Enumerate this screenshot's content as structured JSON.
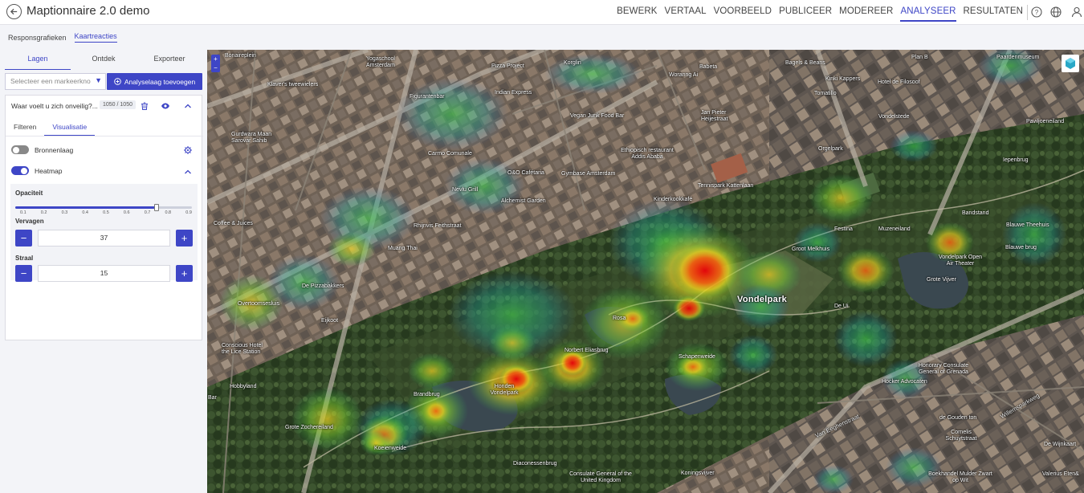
{
  "app": {
    "title": "Maptionnaire 2.0 demo"
  },
  "nav": {
    "items": [
      "BEWERK",
      "VERTAAL",
      "VOORBEELD",
      "PUBLICEER",
      "MODEREER",
      "ANALYSEER",
      "RESULTATEN"
    ],
    "active": "ANALYSEER"
  },
  "subtabs": [
    "Responsgrafieken",
    "Kaartreacties"
  ],
  "panel": {
    "tabs": [
      "Lagen",
      "Ontdek",
      "Exporteer"
    ],
    "select_placeholder": "Selecteer een markeerkno",
    "add_layer_label": "Analyselaag toevoegen",
    "layer": {
      "name": "Waar voelt u zich onveilig?...",
      "count": "1050 / 1050"
    },
    "card_tabs": [
      "Filteren",
      "Visualisatie"
    ],
    "bronnenlaag_label": "Bronnenlaag",
    "heatmap_label": "Heatmap",
    "opacity_label": "Opaciteit",
    "opacity_value": 0.8,
    "opacity_ticks": [
      "0.1",
      "0.2",
      "0.3",
      "0.4",
      "0.5",
      "0.6",
      "0.7",
      "0.8",
      "0.9"
    ],
    "blur_label": "Vervagen",
    "blur_value": "37",
    "radius_label": "Straal",
    "radius_value": "15"
  },
  "map_labels": {
    "vondelpark": "Vondelpark",
    "bonaireplein": "Bonaireplein",
    "yogaschool": "Yogaschool Amsterdam",
    "pizza_project": "Pizza Project",
    "korglin": "Korglin",
    "woranng": "Woranng Ai",
    "bakketa": "Babeta",
    "bagels": "Bagels & Beans",
    "plan_b": "Plan B",
    "paardenmuseum": "Paardenmuseum",
    "klaver": "Klaver's tweewielers",
    "figurantenbar": "Figurantenbar",
    "indian_express": "Indian Express",
    "vegan_junk": "Vegan Junk Food Bar",
    "jan_pieter": "Jan Pieter Heijestraat",
    "kinki": "Kinki Kappers",
    "hotel_filosoof": "Hotel de Filosoof",
    "tomatillo": "Tomatillo",
    "gurdwara": "Gurdwara Maan Sarovar Sahib",
    "vondelstede": "Vondelstede",
    "pavilioen": "Paviljoeneiland",
    "ethiopisch": "Ethiopisch restaurant Addis Ababa",
    "orgelpark": "Orgelpark",
    "iepenbrug": "Iepenbrug",
    "carmo": "Carmo Comunale",
    "danzigerstraat": "Danzigerstraat",
    "cafe_1": "O&O Cafétaria",
    "gymbase": "Gymbase Amsterdam",
    "nevlu": "Nevlu Grill",
    "tennispark": "Tennispark Kattenlaan",
    "alchemist": "Alchemist Garden",
    "kinderkookkafe": "Kinderkookkafé",
    "coffee_juices": "Coffee & Juices",
    "feithstraat": "Rhijnvis Feithstraat",
    "muzeneiland": "Muzeneiland",
    "bandstand": "Bandstand",
    "blauwe_theehuis": "Blauwe Theehuis",
    "fesmle": "Festina",
    "groot_melkhuis": "Groot Melkhuis",
    "vondelpark_open_air": "Vondelpark Open Air Theater",
    "blauwe_brug": "Blauwe brug",
    "muang_thai": "Muang Thai",
    "pizzabakkers": "De Pizzabakkers",
    "vijver": "Grote Vijver",
    "overtoomsesluis": "Overtoomsesluis",
    "de_ui": "De Ui",
    "rosa": "Rosa",
    "eijkoot": "Eijkoot",
    "conscious_hotel": "Conscious Hotel the Lice Station",
    "norbert": "Norbert Eliasbrug",
    "schapenweide": "Schapenweide",
    "honorary_consulate": "Honorary Consulate General of Grenada",
    "hocker": "Hocker Advocaten",
    "hobbyland": "Hobbyland",
    "brandbrug": "Brandbrug",
    "hondenvondelpark": "Honden Vondelpark",
    "grote_zocher": "Grote Zochereiland",
    "koeienweide": "Koeienweide",
    "willemspark": "Willemsparkweg",
    "van_eeghenstraat": "Van Eeghenstraat",
    "gouden_ton": "de Gouden ton",
    "cornelis": "Cornelis Schuytstraat",
    "diaconessenbrug": "Diaconessenbrug",
    "consulate_uk": "Consulate General of the United Kingdom",
    "koningsvijver": "Koningsvijver",
    "boekhandel": "Boekhandel Mulder Zwart op Wit",
    "wijnkaart": "De Wijnkaart",
    "valerius": "Valerius Eten&",
    "bar": "Bar"
  }
}
